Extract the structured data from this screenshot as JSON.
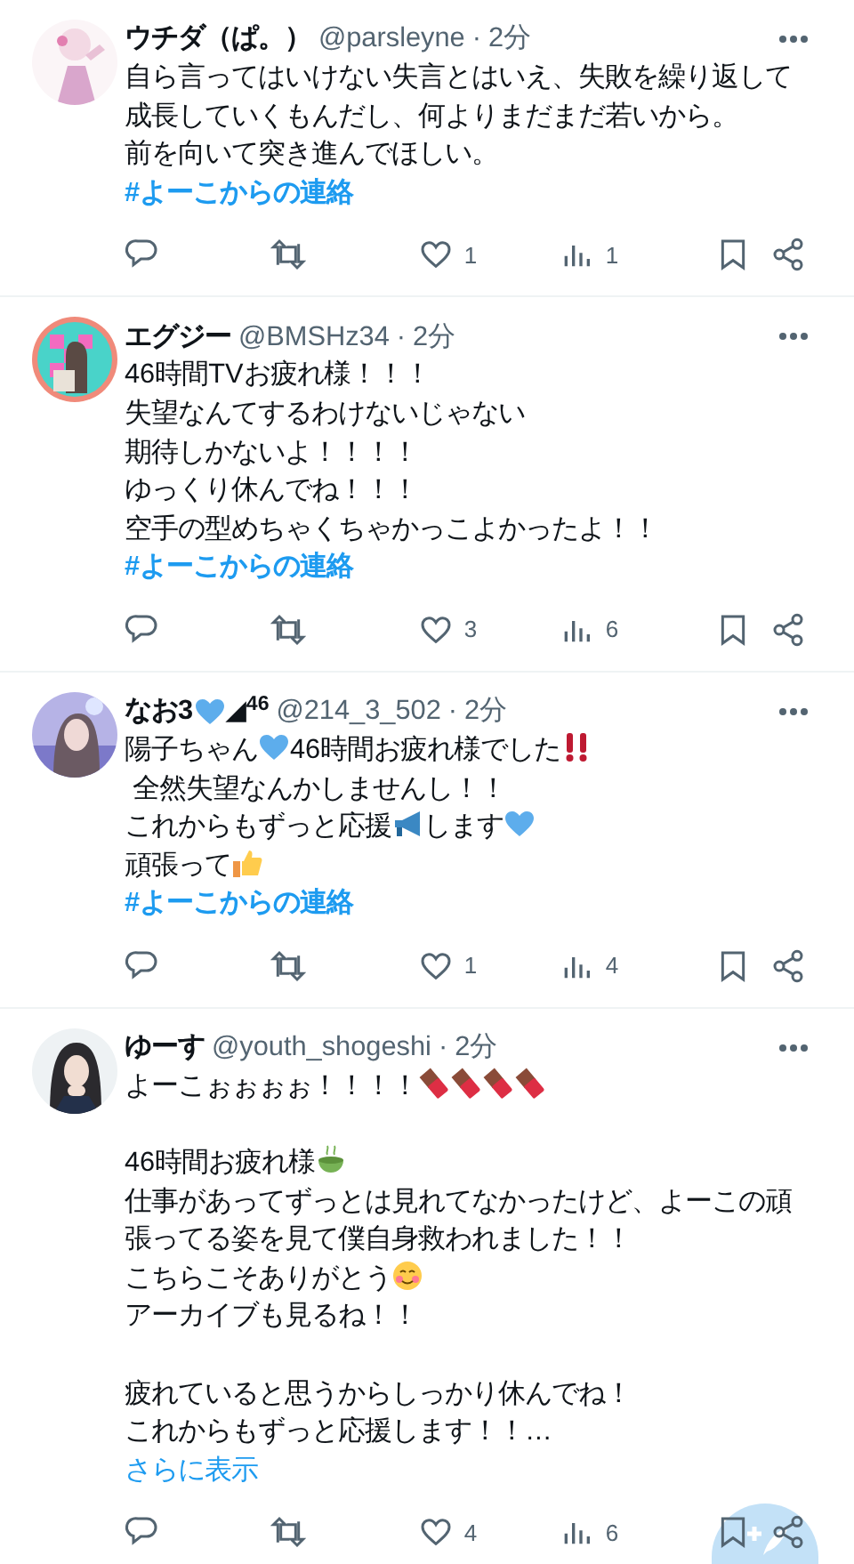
{
  "tweets": [
    {
      "name": "ウチダ（ぱ。）",
      "handle": "@parsleyne",
      "separator": "·",
      "time": "2分",
      "paragraphs": [
        [
          "自ら言ってはいけない失言とはいえ、失敗を繰り返して成長していくもんだし、何よりまだまだ若いから。",
          "前を向いて突き進んでほしい。"
        ]
      ],
      "hashtag": "#よーこからの連絡",
      "likes": "1",
      "views": "1"
    },
    {
      "name": "エグジー",
      "handle": "@BMSHz34",
      "separator": "·",
      "time": "2分",
      "paragraphs": [
        [
          "46時間TVお疲れ様！！！",
          "失望なんてするわけないじゃない",
          "期待しかないよ！！！！",
          "ゆっくり休んでね！！！",
          "空手の型めちゃくちゃかっこよかったよ！！"
        ]
      ],
      "hashtag": "#よーこからの連絡",
      "likes": "3",
      "views": "6"
    },
    {
      "name": [
        {
          "text": "なお3"
        },
        {
          "kind": "heart"
        },
        {
          "text": "◢$^{46}$"
        }
      ],
      "handle": "@214_3_502",
      "separator": "·",
      "time": "2分",
      "paragraphs": [
        [
          [
            {
              "text": "陽子ちゃん"
            },
            {
              "kind": "heart"
            },
            {
              "text": "46時間お疲れ様でした"
            },
            {
              "kind": "bangbang"
            }
          ],
          " 全然失望なんかしませんし！！",
          [
            {
              "text": "これからもずっと応援"
            },
            {
              "kind": "megaphone"
            },
            {
              "text": "します"
            },
            {
              "kind": "heart"
            }
          ],
          [
            {
              "text": "頑張って"
            },
            {
              "kind": "thumb"
            }
          ]
        ]
      ],
      "hashtag": "#よーこからの連絡",
      "likes": "1",
      "views": "4"
    },
    {
      "name": "ゆーす",
      "handle": "@youth_shogeshi",
      "separator": "·",
      "time": "2分",
      "paragraphs": [
        [
          [
            {
              "text": "よーこぉぉぉぉ！！！！"
            },
            {
              "kind": "chocolate"
            },
            {
              "kind": "chocolate"
            },
            {
              "kind": "chocolate"
            },
            {
              "kind": "chocolate"
            }
          ]
        ],
        [
          [
            {
              "text": "46時間お疲れ様"
            },
            {
              "kind": "tea"
            }
          ],
          "仕事があってずっとは見れてなかったけど、よーこの頑張ってる姿を見て僕自身救われました！！",
          [
            {
              "text": "こちらこそありがとう"
            },
            {
              "kind": "smile"
            }
          ],
          "アーカイブも見るね！！"
        ],
        [
          "疲れていると思うからしっかり休んでね！",
          "これからもずっと応援します！！…"
        ]
      ],
      "more": "さらに表示",
      "likes": "4",
      "views": "6"
    }
  ]
}
